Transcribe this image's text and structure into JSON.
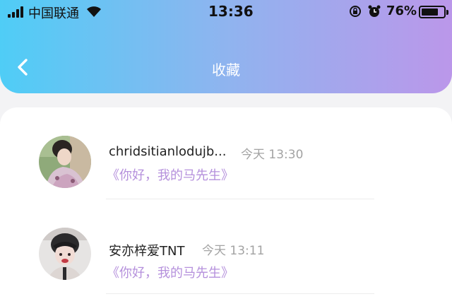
{
  "status_bar": {
    "carrier": "中国联通",
    "time": "13:36",
    "battery_percent": "76%",
    "battery_level": 0.76,
    "icons": [
      "signal-icon",
      "wifi-icon",
      "rotation-lock-icon",
      "alarm-icon",
      "battery-icon"
    ]
  },
  "header": {
    "title": "收藏",
    "back_icon": "chevron-left-icon",
    "gradient": [
      "#4fcdf6",
      "#bb97ea"
    ]
  },
  "favorites": [
    {
      "name": "chridsitianlodujb...",
      "time": "今天 13:30",
      "message": "《你好，我的马先生》"
    },
    {
      "name": "安亦梓爱TNT",
      "time": "今天 13:11",
      "message": "《你好，我的马先生》"
    }
  ],
  "colors": {
    "message": "#b590dc",
    "timestamp": "#a3a3a3"
  }
}
